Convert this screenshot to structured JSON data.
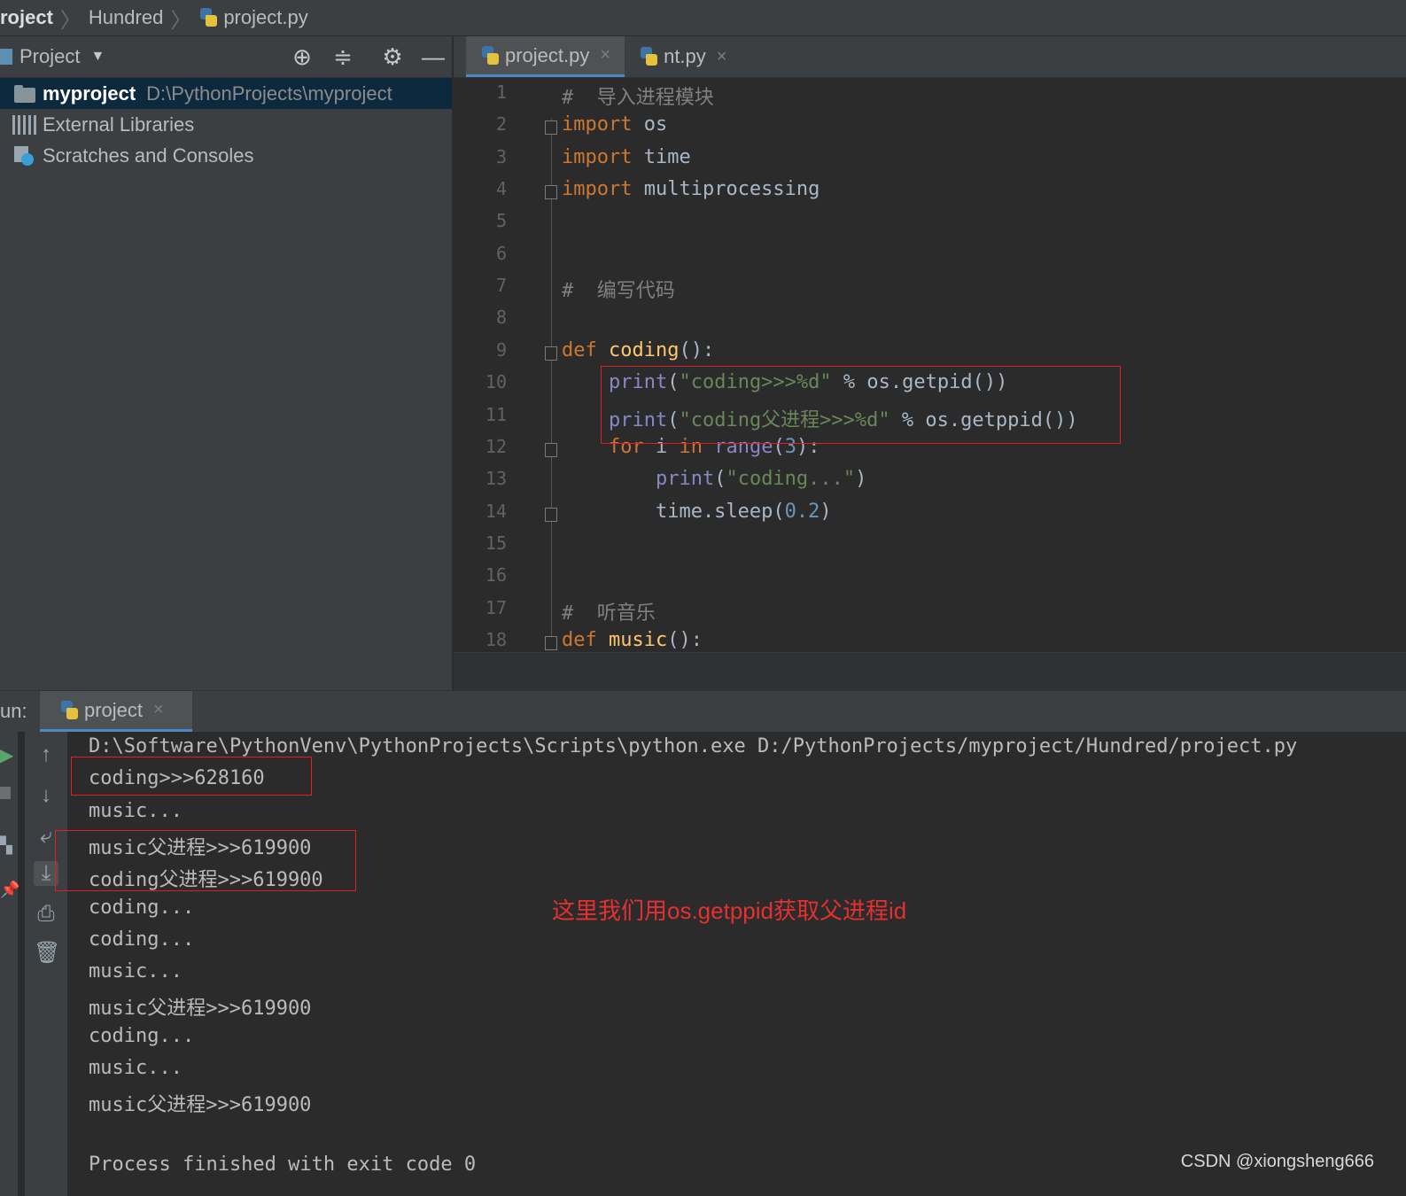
{
  "breadcrumb": [
    "roject",
    "Hundred",
    "project.py"
  ],
  "project_panel": {
    "title": "Project",
    "tree": [
      {
        "name": "myproject",
        "path": "D:\\PythonProjects\\myproject"
      },
      {
        "name": "External Libraries"
      },
      {
        "name": "Scratches and Consoles"
      }
    ]
  },
  "editor": {
    "tabs": [
      {
        "label": "project.py",
        "close": "×"
      },
      {
        "label": "nt.py",
        "close": "×"
      }
    ],
    "line_numbers": [
      "1",
      "2",
      "3",
      "4",
      "5",
      "6",
      "7",
      "8",
      "9",
      "10",
      "11",
      "12",
      "13",
      "14",
      "15",
      "16",
      "17",
      "18"
    ],
    "lines": [
      "#  导入进程模块",
      "import os",
      "import time",
      "import multiprocessing",
      "",
      "",
      "#  编写代码",
      "",
      "def coding():",
      "    print(\"coding>>>%d\" % os.getpid())",
      "    print(\"coding父进程>>>%d\" % os.getppid())",
      "    for i in range(3):",
      "        print(\"coding...\")",
      "        time.sleep(0.2)",
      "",
      "",
      "#  听音乐",
      "def music():"
    ]
  },
  "run": {
    "label": "un:",
    "tab": "project",
    "tab_close": "×",
    "console": [
      "D:\\Software\\PythonVenv\\PythonProjects\\Scripts\\python.exe D:/PythonProjects/myproject/Hundred/project.py",
      "coding>>>628160",
      "music...",
      "music父进程>>>619900",
      "coding父进程>>>619900",
      "coding...",
      "coding...",
      "music...",
      "music父进程>>>619900",
      "coding...",
      "music...",
      "music父进程>>>619900",
      "",
      "Process finished with exit code 0"
    ]
  },
  "annotation": "这里我们用os.getppid获取父进程id",
  "watermark": "CSDN @xiongsheng666",
  "colors": {
    "keyword": "#cc7832",
    "string": "#6a8759",
    "builtin": "#8888c6",
    "function": "#ffc66d",
    "highlight_box": "#e02020"
  }
}
